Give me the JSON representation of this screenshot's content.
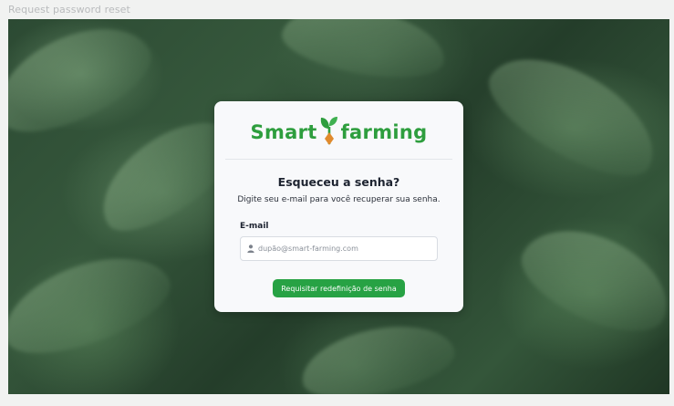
{
  "window": {
    "title": "Request password reset"
  },
  "brand": {
    "word_left": "Smart",
    "word_right": "farming",
    "color": "#2e9e3e",
    "accent": "#e08a2c"
  },
  "form": {
    "heading": "Esqueceu a senha?",
    "subtitle": "Digite seu e-mail para você recuperar sua senha.",
    "email_label": "E-mail",
    "email_placeholder": "dupão@smart-farming.com",
    "email_icon": "user-icon",
    "submit_label": "Requisitar redefinição de senha",
    "submit_color": "#27a244"
  }
}
